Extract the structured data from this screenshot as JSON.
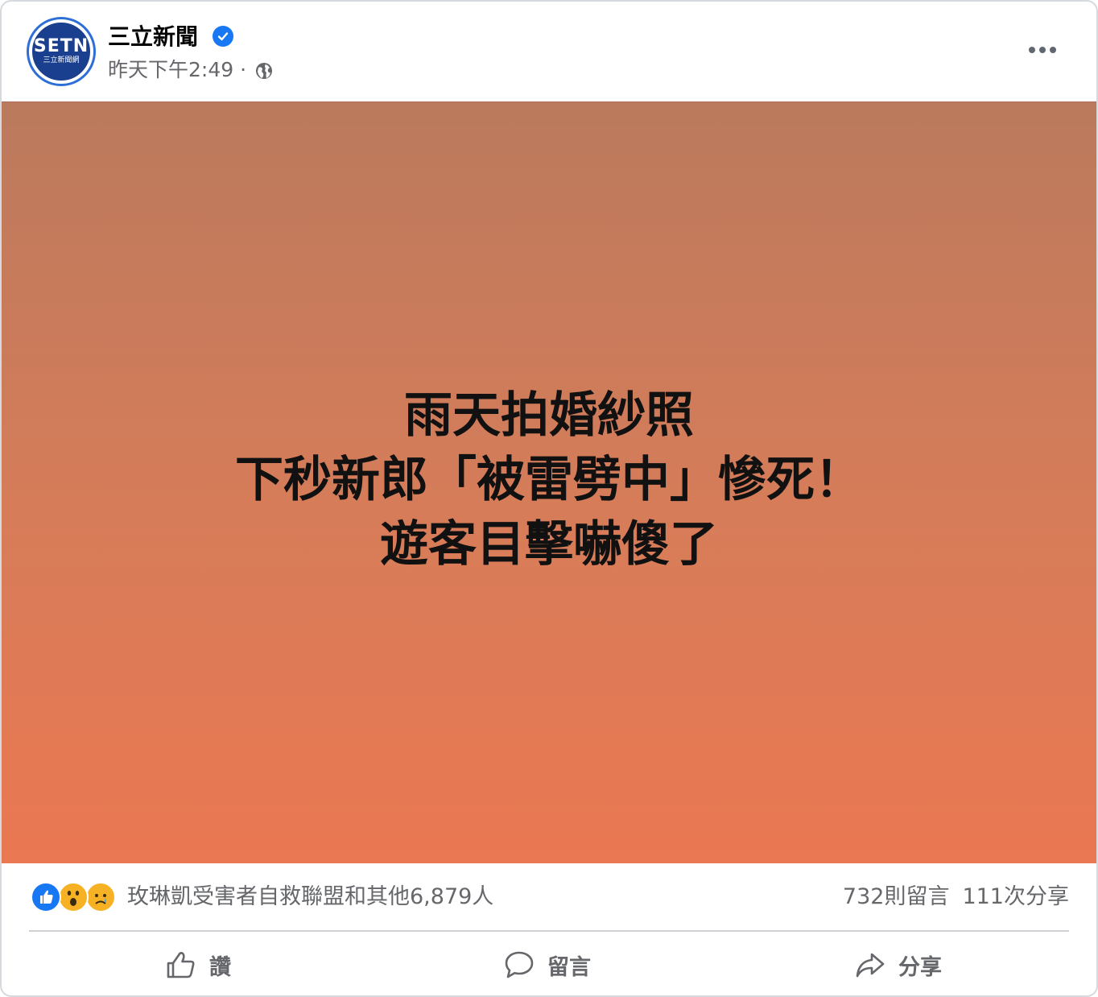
{
  "post": {
    "page_name": "三立新聞",
    "timestamp": "昨天下午2:49 ·",
    "avatar": {
      "logo_main": "SETN",
      "logo_sub": "三立新聞網"
    },
    "headline": [
      "雨天拍婚紗照",
      "下秒新郎「被雷劈中」慘死！",
      "遊客目擊嚇傻了"
    ],
    "reactions": {
      "icons": [
        "like-icon",
        "wow-icon",
        "sad-icon"
      ],
      "summary": "玫琳凱受害者自救聯盟和其他6,879人"
    },
    "comments_count": "732則留言",
    "shares_count": "111次分享",
    "actions": {
      "like": "讚",
      "comment": "留言",
      "share": "分享"
    },
    "colors": {
      "accent": "#1877f2",
      "secondary_text": "#65676b",
      "image_top": "#bb7a5d",
      "image_bottom": "#ea7852"
    }
  }
}
